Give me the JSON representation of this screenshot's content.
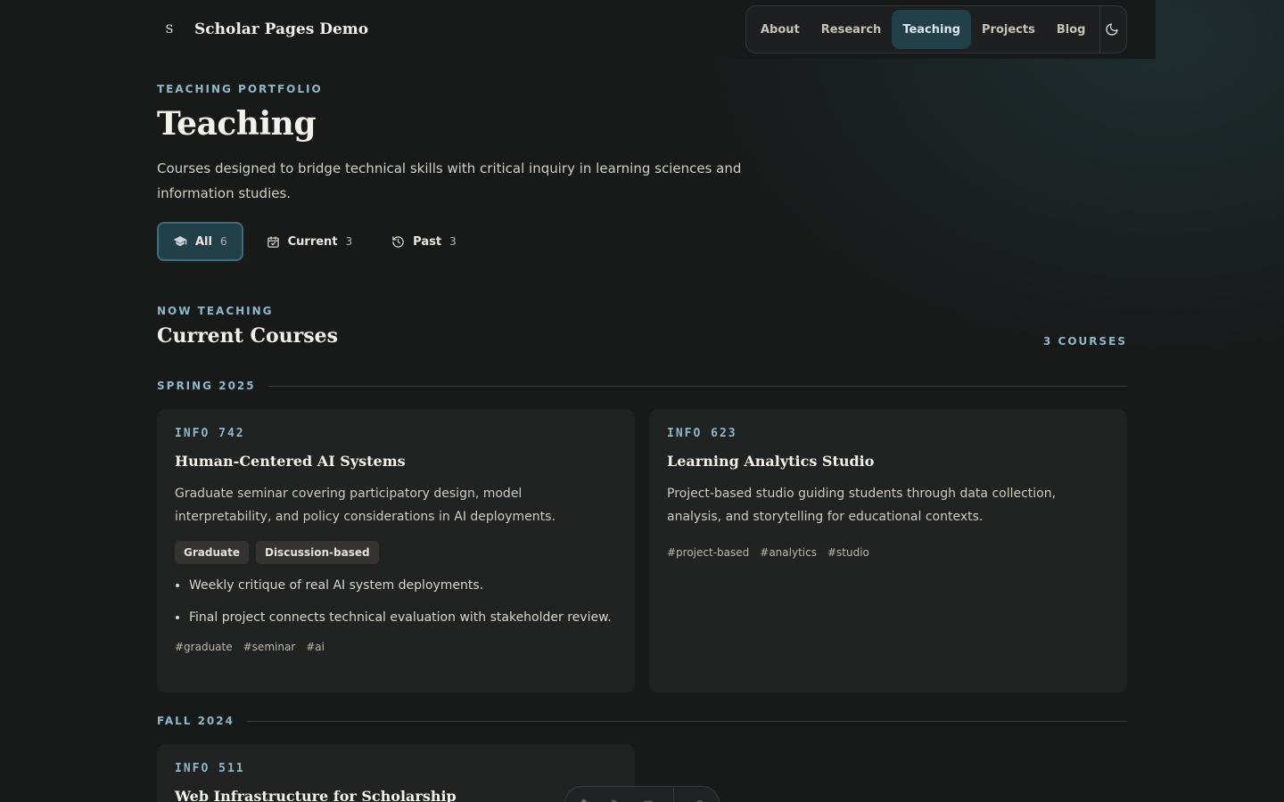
{
  "brand": {
    "mark": "S",
    "name": "Scholar Pages Demo"
  },
  "nav": {
    "items": [
      {
        "label": "About",
        "active": false
      },
      {
        "label": "Research",
        "active": false
      },
      {
        "label": "Teaching",
        "active": true
      },
      {
        "label": "Projects",
        "active": false
      },
      {
        "label": "Blog",
        "active": false
      }
    ],
    "theme_icon": "moon-icon"
  },
  "hero": {
    "eyebrow": "TEACHING PORTFOLIO",
    "title": "Teaching",
    "lead": "Courses designed to bridge technical skills with critical inquiry in learning sciences and information studies."
  },
  "filters": [
    {
      "label": "All",
      "count": "6",
      "icon": "graduation-cap-icon",
      "active": true
    },
    {
      "label": "Current",
      "count": "3",
      "icon": "calendar-check-icon",
      "active": false
    },
    {
      "label": "Past",
      "count": "3",
      "icon": "history-icon",
      "active": false
    }
  ],
  "section": {
    "eyebrow": "NOW TEACHING",
    "title": "Current Courses",
    "count": "3 COURSES"
  },
  "terms": [
    {
      "label": "SPRING 2025",
      "courses": [
        {
          "code": "INFO 742",
          "title": "Human-Centered AI Systems",
          "description": "Graduate seminar covering participatory design, model interpretability, and policy considerations in AI deployments.",
          "badges": [
            "Graduate",
            "Discussion-based"
          ],
          "bullets": [
            "Weekly critique of real AI system deployments.",
            "Final project connects technical evaluation with stakeholder review."
          ],
          "tags": [
            "#graduate",
            "#seminar",
            "#ai"
          ]
        },
        {
          "code": "INFO 623",
          "title": "Learning Analytics Studio",
          "description": "Project-based studio guiding students through data collection, analysis, and storytelling for educational contexts.",
          "badges": [],
          "bullets": [],
          "tags": [
            "#project-based",
            "#analytics",
            "#studio"
          ]
        }
      ]
    },
    {
      "label": "FALL 2024",
      "courses": [
        {
          "code": "INFO 511",
          "title": "Web Infrastructure for Scholarship"
        }
      ]
    }
  ],
  "colors": {
    "accent": "#8cb9c9",
    "active_bg": "#22404a",
    "background": "#181919",
    "card": "#212222"
  }
}
